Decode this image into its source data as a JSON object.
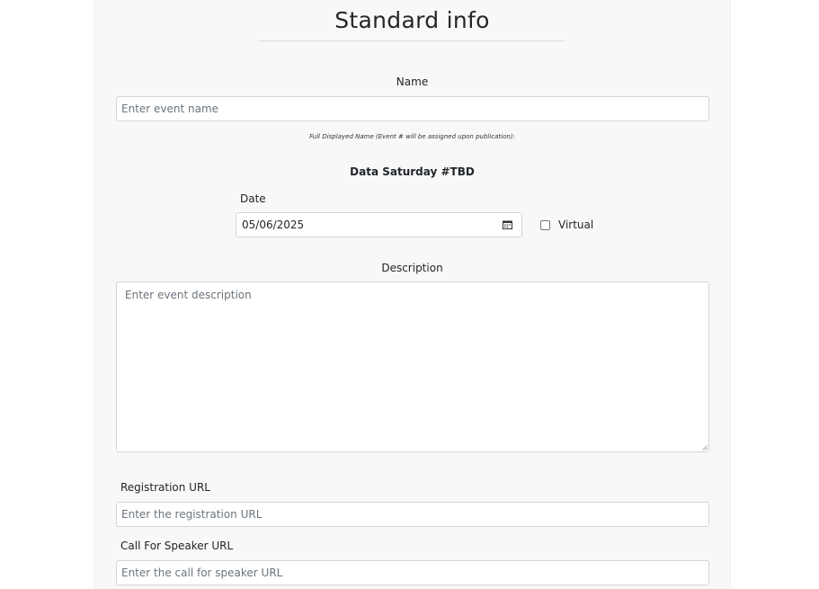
{
  "section": {
    "title": "Standard info"
  },
  "name_field": {
    "label": "Name",
    "placeholder": "Enter event name",
    "hint": "Full Displayed Name (Event # will be assigned upon publication):",
    "display_name": "Data Saturday #TBD"
  },
  "date_field": {
    "label": "Date",
    "value": "05/06/2025",
    "icon": "calendar-icon"
  },
  "virtual_field": {
    "label": "Virtual",
    "checked": false
  },
  "description_field": {
    "label": "Description",
    "placeholder": "Enter event description"
  },
  "registration_field": {
    "label": "Registration URL",
    "placeholder": "Enter the registration URL"
  },
  "cfs_field": {
    "label": "Call For Speaker URL",
    "placeholder": "Enter the call for speaker URL"
  }
}
